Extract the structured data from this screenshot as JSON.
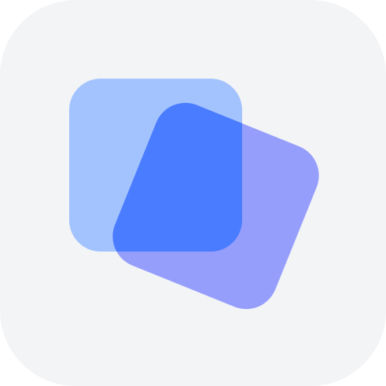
{
  "icon": {
    "name": "overlapping-squares-app-icon",
    "colors": {
      "tile_background": "#F3F4F6",
      "back_square": "#A3C3FF",
      "front_square": "#969EFC",
      "overlap_highlight": "#4A7CFF"
    }
  }
}
